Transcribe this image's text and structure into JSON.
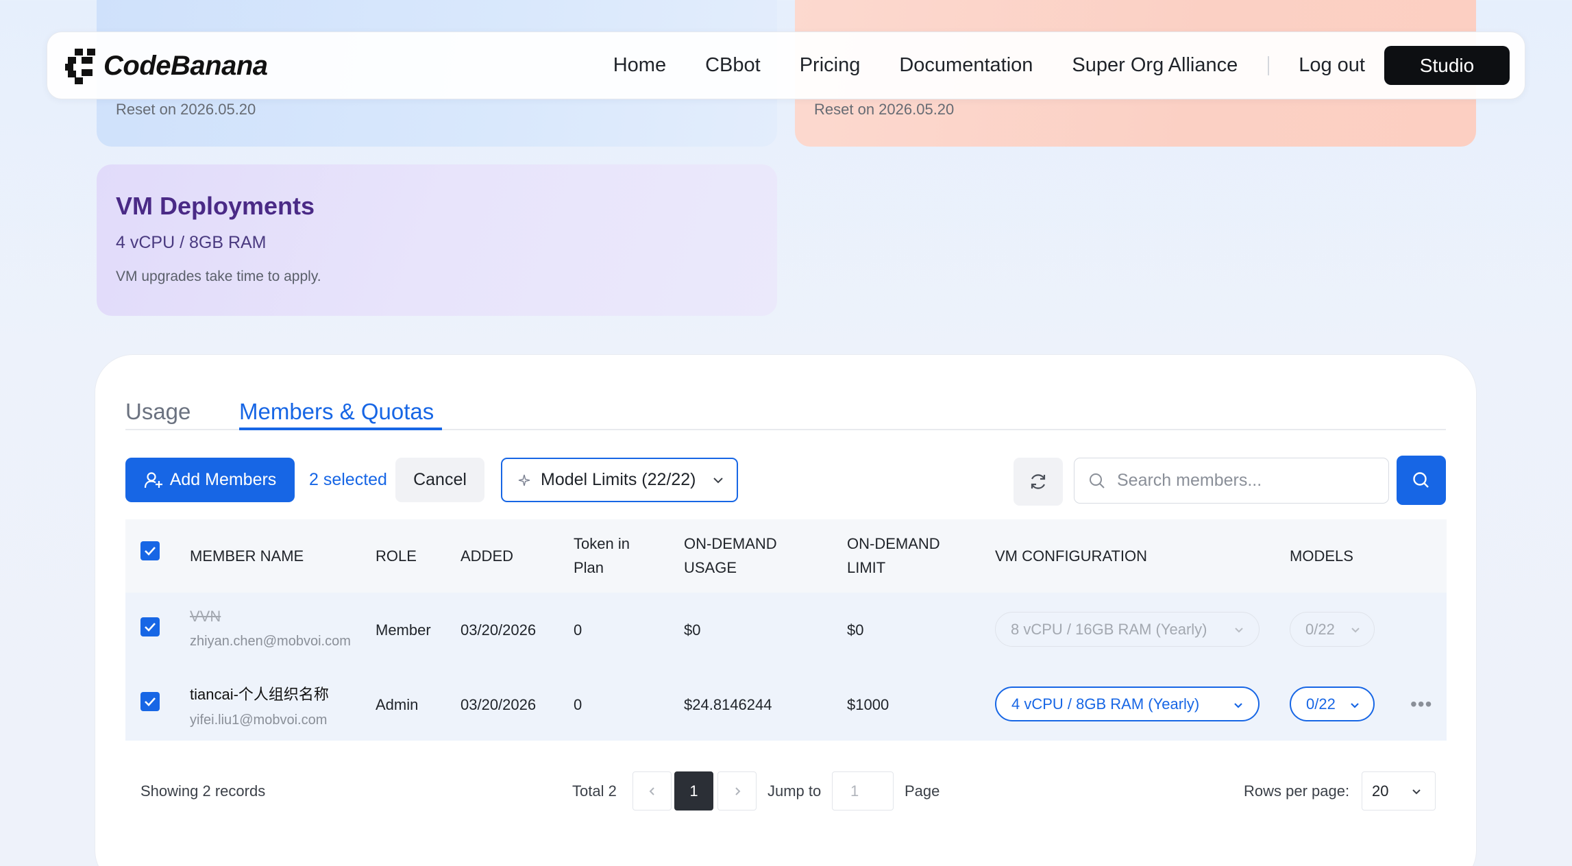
{
  "cards": {
    "top_left_reset": "Reset on 2026.05.20",
    "top_right_reset": "Reset on 2026.05.20",
    "vm": {
      "title": "VM Deployments",
      "spec": "4 vCPU / 8GB RAM",
      "note": "VM upgrades take time to apply."
    }
  },
  "nav": {
    "brand": "CodeBanana",
    "links": [
      "Home",
      "CBbot",
      "Pricing",
      "Documentation",
      "Super Org Alliance"
    ],
    "logout": "Log out",
    "studio": "Studio"
  },
  "tabs": [
    {
      "label": "Usage",
      "active": false
    },
    {
      "label": "Members & Quotas",
      "active": true
    }
  ],
  "toolbar": {
    "add_members": "Add Members",
    "selected": "2 selected",
    "cancel": "Cancel",
    "model_limits": "Model Limits (22/22)",
    "search_placeholder": "Search members..."
  },
  "table": {
    "headers": {
      "member_name": "MEMBER NAME",
      "role": "ROLE",
      "added": "ADDED",
      "token_in_plan_1": "Token in",
      "token_in_plan_2": "Plan",
      "ondemand_usage_1": "ON-DEMAND",
      "ondemand_usage_2": "USAGE",
      "ondemand_limit_1": "ON-DEMAND",
      "ondemand_limit_2": "LIMIT",
      "vm_configuration": "VM CONFIGURATION",
      "models": "MODELS"
    },
    "rows": [
      {
        "name": "VVN",
        "email": "zhiyan.chen@mobvoi.com",
        "role": "Member",
        "added": "03/20/2026",
        "token": "0",
        "usage": "$0",
        "limit": "$0",
        "vm": "8 vCPU / 16GB RAM (Yearly)",
        "models": "0/22"
      },
      {
        "name": "tiancai-个人组织名称",
        "email": "yifei.liu1@mobvoi.com",
        "role": "Admin",
        "added": "03/20/2026",
        "token": "0",
        "usage": "$24.8146244",
        "limit": "$1000",
        "vm": "4 vCPU / 8GB RAM (Yearly)",
        "models": "0/22"
      }
    ]
  },
  "footer": {
    "showing": "Showing 2 records",
    "total": "Total 2",
    "current_page": "1",
    "jump_to": "Jump to",
    "jump_placeholder": "1",
    "page": "Page",
    "rows_per_page": "Rows per page:",
    "rows_value": "20"
  },
  "colors": {
    "accent": "#1766e5",
    "vm_title": "#4a2a86",
    "dark_button": "#0d0f12"
  }
}
